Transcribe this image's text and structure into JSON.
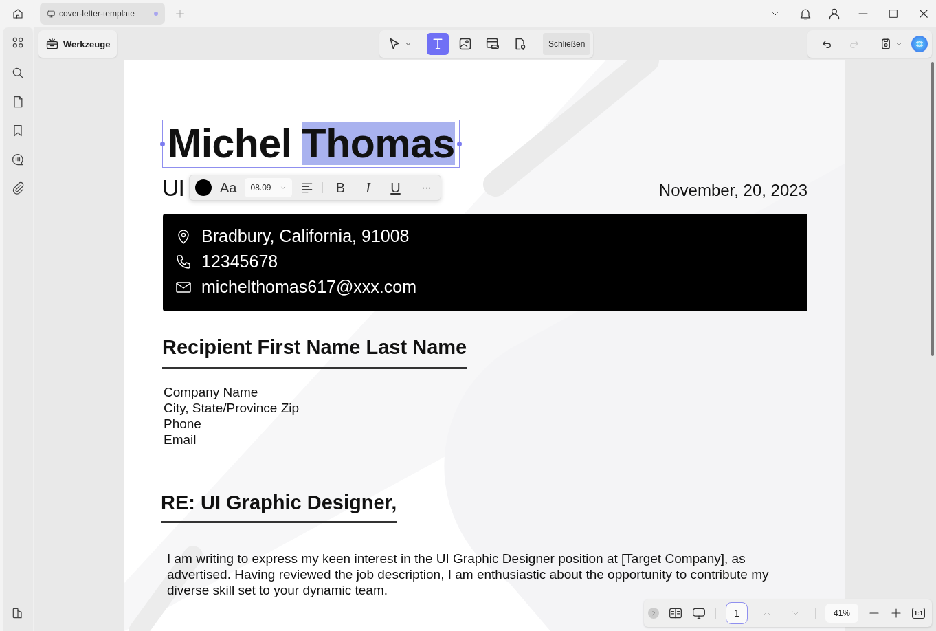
{
  "tabs": [
    {
      "label": "cover-letter-template",
      "selected": true,
      "modified": true
    }
  ],
  "toolbar": {
    "tools_button": "Werkzeuge",
    "tools": [
      {
        "kind": "select",
        "selected": false
      },
      {
        "kind": "text",
        "selected": true
      },
      {
        "kind": "image",
        "selected": false
      },
      {
        "kind": "link",
        "selected": false
      },
      {
        "kind": "stamp",
        "selected": false
      }
    ],
    "close_button": "Schließen",
    "history": [
      {
        "kind": "undo",
        "disabled": false
      },
      {
        "kind": "redo",
        "disabled": true
      }
    ]
  },
  "sidebar": {
    "items": [
      {
        "kind": "search"
      },
      {
        "kind": "page"
      },
      {
        "kind": "bookmark"
      },
      {
        "kind": "comment"
      },
      {
        "kind": "attachment"
      }
    ]
  },
  "document": {
    "name": [
      {
        "text": "Michel",
        "selected": false
      },
      {
        "text": "Thomas",
        "selected": true
      }
    ],
    "subtitle": "UI",
    "date": "November, 20, 2023",
    "contact": [
      {
        "kind": "location",
        "text": "Bradbury, California, 91008"
      },
      {
        "kind": "phone",
        "text": "12345678"
      },
      {
        "kind": "mail",
        "text": "michelthomas617@xxx.com"
      }
    ],
    "recipient_heading": "Recipient First Name Last Name",
    "address_lines": [
      "Company Name",
      "City, State/Province Zip",
      "Phone",
      "Email"
    ],
    "re_heading": "RE: UI Graphic Designer,",
    "body": "I am writing to express my keen interest in the UI Graphic Designer position at [Target Company], as advertised. Having reviewed the job description, I am enthusiastic about the opportunity to contribute my diverse skill set to your dynamic team."
  },
  "format_toolbar": {
    "font_button": "Aa",
    "font_size": "08.09",
    "style_buttons": [
      {
        "kind": "bold",
        "label": "B"
      },
      {
        "kind": "italic",
        "label": "I"
      },
      {
        "kind": "underline",
        "label": "U"
      }
    ],
    "more_button": "···"
  },
  "zoom_bar": {
    "page": "1",
    "zoom": "41%",
    "actual_size": "1:1"
  }
}
